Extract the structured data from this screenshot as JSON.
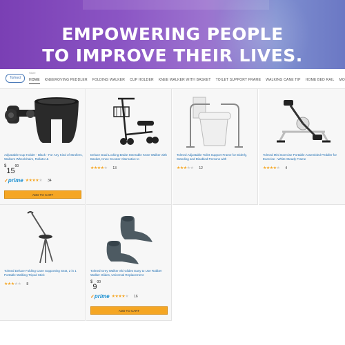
{
  "hero": {
    "line1": "EMPOWERING PEOPLE",
    "line2": "TO IMPROVE THEIR LIVES."
  },
  "navbar": {
    "logo_text": "Tolmed",
    "sub_label": "Store",
    "items": [
      {
        "label": "HOME",
        "active": true
      },
      {
        "label": "KNEEROVING PEDDLER",
        "active": false
      },
      {
        "label": "FOLDING WALKER",
        "active": false
      },
      {
        "label": "CUP HOLDER",
        "active": false
      },
      {
        "label": "KNEE WALKER WITH BASKET",
        "active": false
      },
      {
        "label": "TOILET SUPPORT FRAME",
        "active": false
      },
      {
        "label": "WALKING CANE TIP",
        "active": false
      },
      {
        "label": "HOME BED RAIL",
        "active": false
      },
      {
        "label": "MORE",
        "active": false
      }
    ]
  },
  "products": [
    {
      "icon": "cup-holder",
      "title": "Adjustable Cup Holder - Black - For Any Kind of Strollers, Walkers Wheelchairs, Rollator &",
      "price_currency": "$",
      "price_dollars": "15",
      "price_cents": "00",
      "prime": "prime",
      "stars": 4,
      "reviews": "34",
      "cart_label": "ADD TO CART"
    },
    {
      "icon": "knee-walker",
      "title": "Deluxe Dual Locking Brake Steerable Knee Walker with Basket, Knee Scooter Alternative to",
      "stars": 4,
      "reviews": "13"
    },
    {
      "icon": "toilet-frame",
      "title": "Tolmed Adjustable Toilet Support Frame for Elderly, Standing and Disabled Persons with",
      "stars": 3,
      "reviews": "12"
    },
    {
      "icon": "pedal-exerciser",
      "title": "Tolmed Mini Exercise Portable Assembled Peddler for Exercise - White Steady Frame",
      "stars": 4,
      "reviews": "4"
    },
    {
      "icon": "folding-cane",
      "title": "Tolmed Deluxe Folding Cane Supporting Seat, 2 in 1 Portable Walking Tripod Stick",
      "stars": 3,
      "reviews": "8"
    },
    {
      "icon": "walker-skis",
      "title": "Tolmed Grey Walker Ski Glides Easy to Use Rubber Walker Glides, Universal Replacement",
      "price_currency": "$",
      "price_dollars": "9",
      "price_cents": "00",
      "prime": "prime",
      "stars": 4,
      "reviews": "16",
      "cart_label": "ADD TO CART"
    }
  ],
  "colors": {
    "accent_orange": "#f5a623",
    "link_blue": "#1f6fb3",
    "prime_blue": "#1a8fd0"
  }
}
